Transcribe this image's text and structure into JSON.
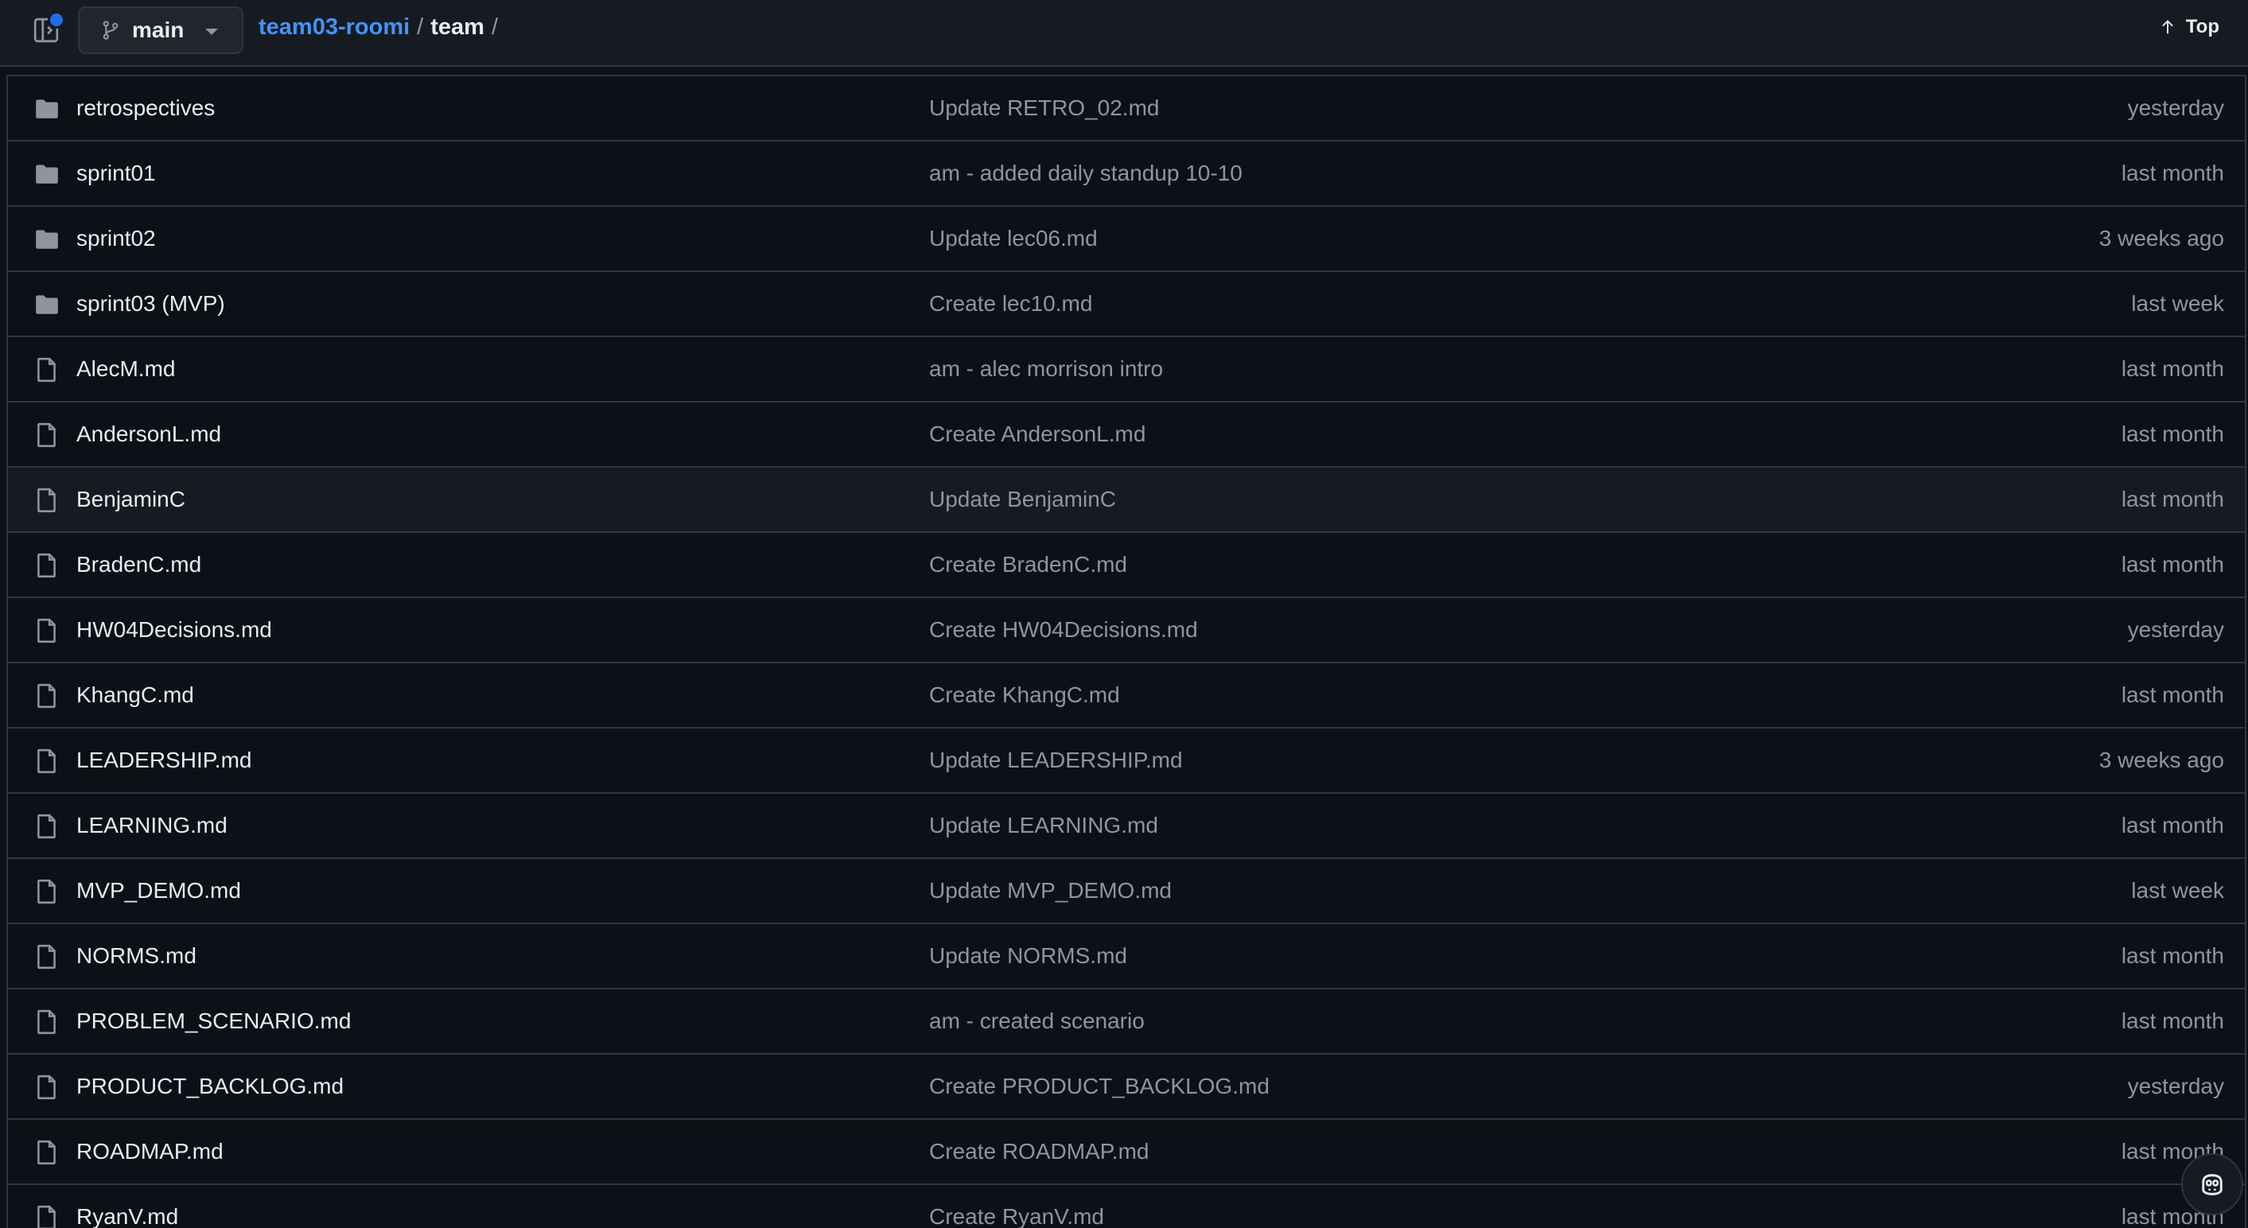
{
  "header": {
    "branch": "main",
    "breadcrumb": {
      "repo": "team03-roomi",
      "separator1": "/",
      "dir": "team",
      "separator2": "/"
    },
    "top_link": "Top"
  },
  "files": [
    {
      "type": "folder",
      "name": "retrospectives",
      "commit": "Update RETRO_02.md",
      "date": "yesterday"
    },
    {
      "type": "folder",
      "name": "sprint01",
      "commit": "am - added daily standup 10-10",
      "date": "last month"
    },
    {
      "type": "folder",
      "name": "sprint02",
      "commit": "Update lec06.md",
      "date": "3 weeks ago"
    },
    {
      "type": "folder",
      "name": "sprint03 (MVP)",
      "commit": "Create lec10.md",
      "date": "last week"
    },
    {
      "type": "file",
      "name": "AlecM.md",
      "commit": "am - alec morrison intro",
      "date": "last month"
    },
    {
      "type": "file",
      "name": "AndersonL.md",
      "commit": "Create AndersonL.md",
      "date": "last month"
    },
    {
      "type": "file",
      "name": "BenjaminC",
      "commit": "Update BenjaminC",
      "date": "last month"
    },
    {
      "type": "file",
      "name": "BradenC.md",
      "commit": "Create BradenC.md",
      "date": "last month"
    },
    {
      "type": "file",
      "name": "HW04Decisions.md",
      "commit": "Create HW04Decisions.md",
      "date": "yesterday"
    },
    {
      "type": "file",
      "name": "KhangC.md",
      "commit": "Create KhangC.md",
      "date": "last month"
    },
    {
      "type": "file",
      "name": "LEADERSHIP.md",
      "commit": "Update LEADERSHIP.md",
      "date": "3 weeks ago"
    },
    {
      "type": "file",
      "name": "LEARNING.md",
      "commit": "Update LEARNING.md",
      "date": "last month"
    },
    {
      "type": "file",
      "name": "MVP_DEMO.md",
      "commit": "Update MVP_DEMO.md",
      "date": "last week"
    },
    {
      "type": "file",
      "name": "NORMS.md",
      "commit": "Update NORMS.md",
      "date": "last month"
    },
    {
      "type": "file",
      "name": "PROBLEM_SCENARIO.md",
      "commit": "am - created scenario",
      "date": "last month"
    },
    {
      "type": "file",
      "name": "PRODUCT_BACKLOG.md",
      "commit": "Create PRODUCT_BACKLOG.md",
      "date": "yesterday"
    },
    {
      "type": "file",
      "name": "ROADMAP.md",
      "commit": "Create ROADMAP.md",
      "date": "last month"
    },
    {
      "type": "file",
      "name": "RyanV.md",
      "commit": "Create RyanV.md",
      "date": "last month"
    }
  ],
  "colors": {
    "background": "#0d1117",
    "header_bg": "#161b22",
    "border": "#30363d",
    "link": "#4493f8",
    "muted": "#8d96a0",
    "text": "#e6edf3"
  },
  "icons": {
    "folder": "folder-icon",
    "file": "file-icon",
    "sidebar": "sidebar-toggle-icon",
    "branch": "git-branch-icon",
    "arrow_up": "arrow-up-icon",
    "copilot": "copilot-icon"
  }
}
